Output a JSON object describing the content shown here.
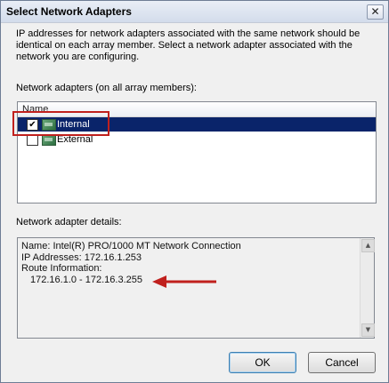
{
  "window": {
    "title": "Select Network Adapters",
    "close_glyph": "✕"
  },
  "intro_text": "IP addresses for network adapters associated with the same network should be identical on each array member. Select a network adapter associated with the network you are configuring.",
  "adapters": {
    "label": "Network adapters (on all array members):",
    "column_header": "Name",
    "items": [
      {
        "name": "Internal",
        "checked": true,
        "selected": true,
        "check_glyph": "✔",
        "icon": "network-adapter-icon"
      },
      {
        "name": "External",
        "checked": false,
        "selected": false,
        "check_glyph": "",
        "icon": "network-adapter-icon"
      }
    ]
  },
  "details": {
    "label": "Network adapter details:",
    "name_line": "Name: Intel(R) PRO/1000 MT Network Connection",
    "ip_line": "IP Addresses: 172.16.1.253",
    "route_label": "Route Information:",
    "route_value": "172.16.1.0 - 172.16.3.255",
    "scroll_up_glyph": "▲",
    "scroll_down_glyph": "▼"
  },
  "annotation": {
    "highlight_color": "#c0201d",
    "arrow_color": "#c0201d"
  },
  "buttons": {
    "ok": "OK",
    "cancel": "Cancel"
  }
}
